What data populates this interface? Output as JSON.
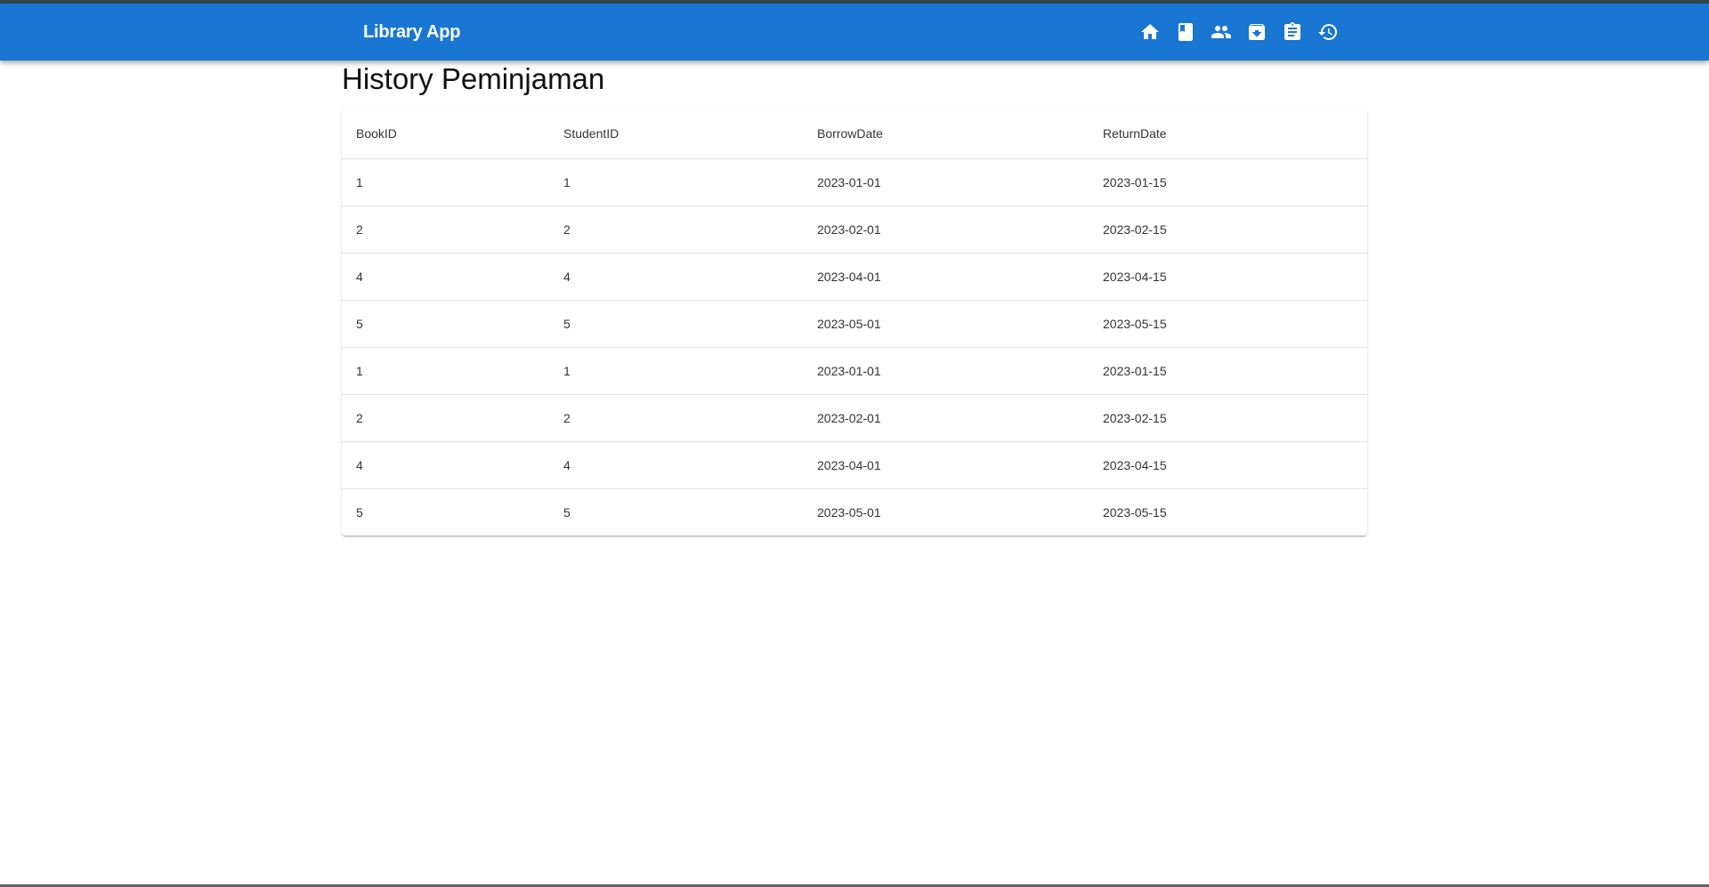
{
  "app": {
    "title": "Library App",
    "accent_color": "#1976d2"
  },
  "nav": {
    "items": [
      {
        "name": "home",
        "icon": "home-icon"
      },
      {
        "name": "books",
        "icon": "book-icon"
      },
      {
        "name": "students",
        "icon": "people-icon"
      },
      {
        "name": "archive",
        "icon": "archive-icon"
      },
      {
        "name": "assignment",
        "icon": "clipboard-icon"
      },
      {
        "name": "history",
        "icon": "history-icon"
      }
    ]
  },
  "page": {
    "title": "History Peminjaman"
  },
  "table": {
    "headers": [
      "BookID",
      "StudentID",
      "BorrowDate",
      "ReturnDate"
    ],
    "rows": [
      [
        "1",
        "1",
        "2023-01-01",
        "2023-01-15"
      ],
      [
        "2",
        "2",
        "2023-02-01",
        "2023-02-15"
      ],
      [
        "4",
        "4",
        "2023-04-01",
        "2023-04-15"
      ],
      [
        "5",
        "5",
        "2023-05-01",
        "2023-05-15"
      ],
      [
        "1",
        "1",
        "2023-01-01",
        "2023-01-15"
      ],
      [
        "2",
        "2",
        "2023-02-01",
        "2023-02-15"
      ],
      [
        "4",
        "4",
        "2023-04-01",
        "2023-04-15"
      ],
      [
        "5",
        "5",
        "2023-05-01",
        "2023-05-15"
      ]
    ]
  }
}
